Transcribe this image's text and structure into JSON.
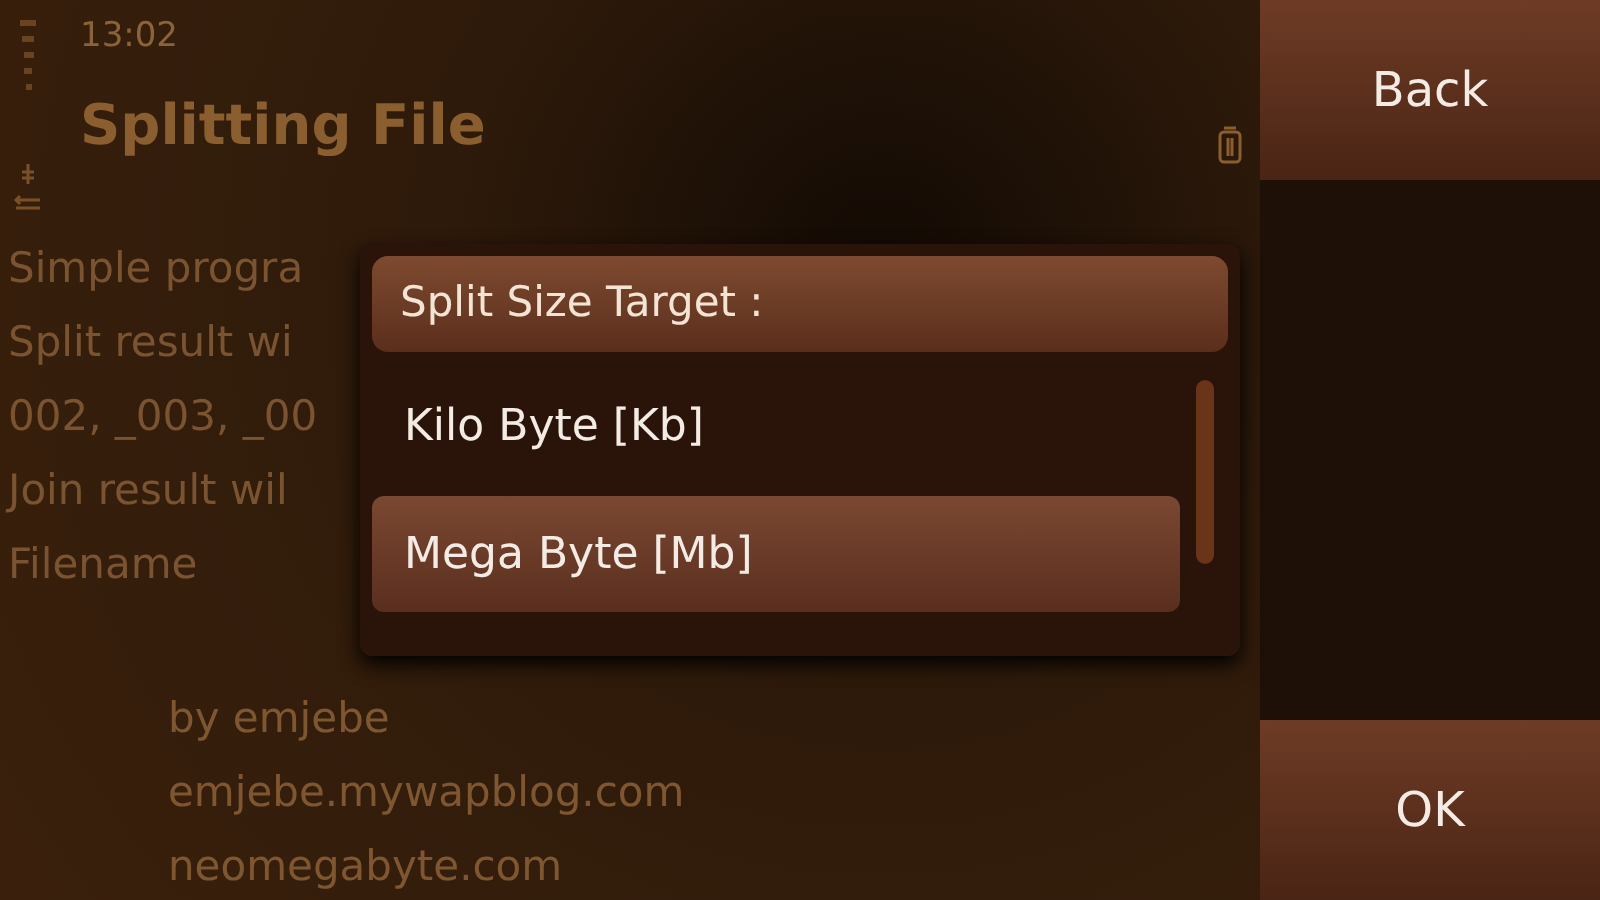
{
  "status_bar": {
    "time": "13:02"
  },
  "title": "Splitting File",
  "description_lines": [
    "Simple progra",
    "Split result wi",
    "002, _003, _00",
    "Join result wil",
    "Filename"
  ],
  "credits": [
    "by emjebe",
    "emjebe.mywapblog.com",
    "neomegabyte.com"
  ],
  "popup": {
    "title": "Split Size Target :",
    "options": [
      {
        "label": "Kilo Byte [Kb]",
        "selected": false
      },
      {
        "label": "Mega Byte [Mb]",
        "selected": true
      }
    ]
  },
  "softkeys": {
    "top": "Back",
    "bottom": "OK"
  }
}
